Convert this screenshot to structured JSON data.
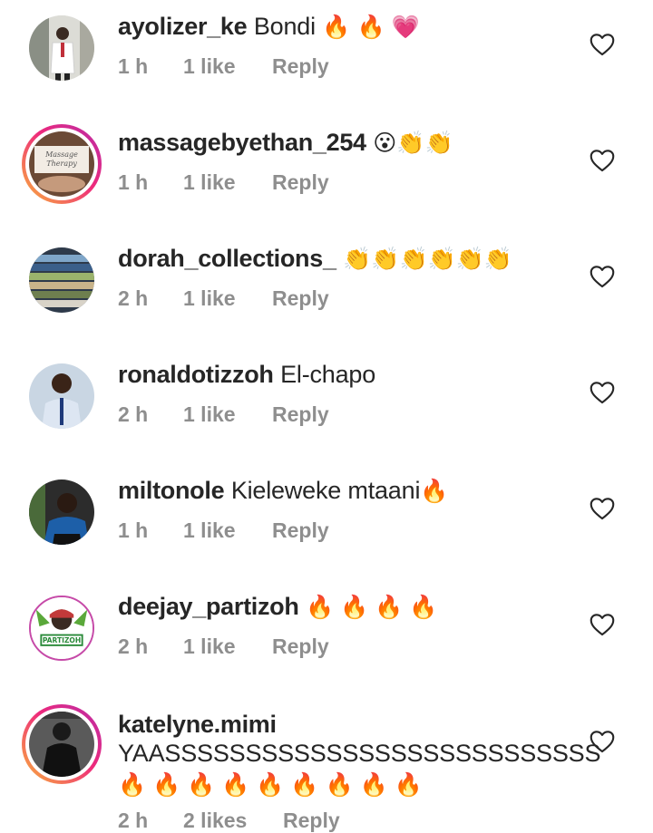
{
  "comments": [
    {
      "username": "ayolizer_ke",
      "text": "Bondi",
      "emoji": "🔥 🔥 💗",
      "time": "1 h",
      "likes": "1 like",
      "reply": "Reply"
    },
    {
      "username": "massagebyethan_254",
      "text": "",
      "emoji": "😮👏👏",
      "time": "1 h",
      "likes": "1 like",
      "reply": "Reply",
      "avatar_text_1": "Massage",
      "avatar_text_2": "Therapy"
    },
    {
      "username": "dorah_collections_",
      "text": "",
      "emoji": "👏👏👏👏👏👏",
      "time": "2 h",
      "likes": "1 like",
      "reply": "Reply"
    },
    {
      "username": "ronaldotizzoh",
      "text": "El-chapo",
      "emoji": "",
      "time": "2 h",
      "likes": "1 like",
      "reply": "Reply"
    },
    {
      "username": "miltonole",
      "text": "Kieleweke mtaani",
      "emoji": "🔥",
      "time": "1 h",
      "likes": "1 like",
      "reply": "Reply"
    },
    {
      "username": "deejay_partizoh",
      "text": "",
      "emoji": "🔥 🔥 🔥 🔥",
      "time": "2 h",
      "likes": "1 like",
      "reply": "Reply",
      "avatar_text_1": "PARTIZOH"
    },
    {
      "username": "katelyne.mimi",
      "text": "YAASSSSSSSSSSSSSSSSSSSSSSSSSSS",
      "emoji": "🔥 🔥 🔥 🔥 🔥 🔥 🔥 🔥 🔥",
      "time": "2 h",
      "likes": "2 likes",
      "reply": "Reply"
    }
  ],
  "colors": {
    "text": "#262626",
    "meta": "#8e8e8e",
    "story_ring_start": "#f9b63a",
    "story_ring_end": "#b82ca8"
  },
  "icons": {
    "like": "heart-outline-icon"
  }
}
